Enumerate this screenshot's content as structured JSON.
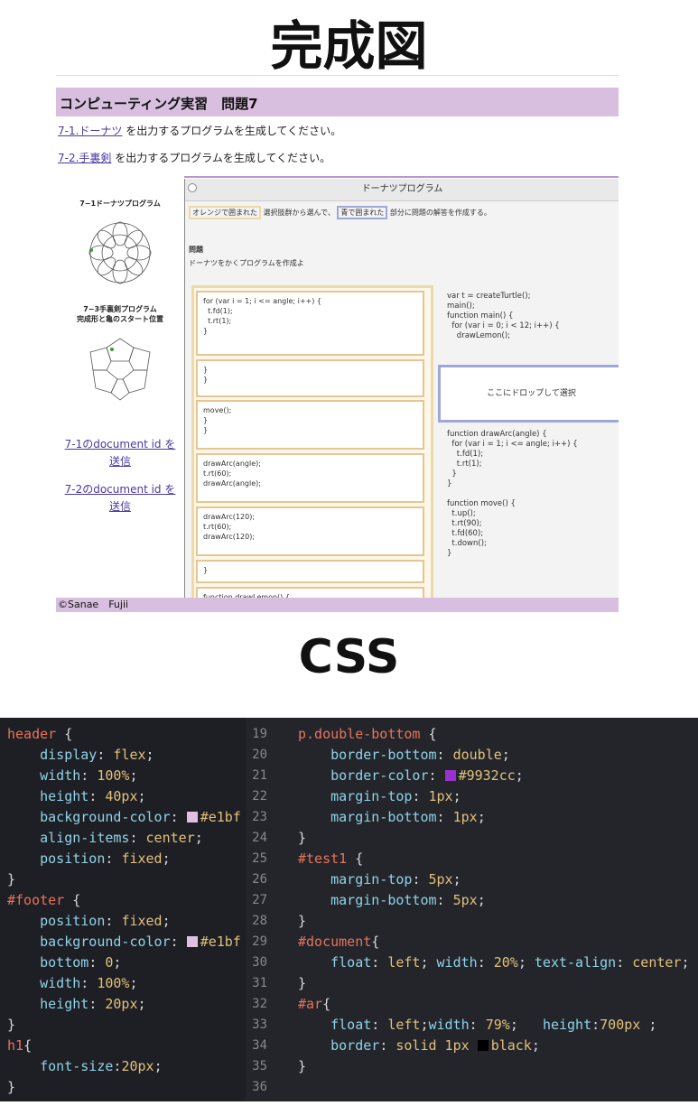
{
  "titles": {
    "top": "完成図",
    "css": "CSS"
  },
  "page": {
    "header": "コンピューティング実習　問題7",
    "q1": {
      "link": "7-1.ドーナツ",
      "text": " を出力するプログラムを生成してください。"
    },
    "q2": {
      "link": "7-2.手裏剣",
      "text": " を出力するプログラムを生成してください。"
    },
    "left": {
      "fig1": "7−1ドーナツプログラム",
      "fig2_line1": "7−3手裏剣プログラム",
      "fig2_line2": "完成形と亀のスタート位置",
      "link1_a": "7-1のdocument id を",
      "link1_b": "送信",
      "link2_a": "7-2のdocument id を",
      "link2_b": "送信"
    },
    "ar": {
      "title": "ドーナツプログラム",
      "instr_orange": "オレンジで囲まれた",
      "instr_mid": "選択肢群から選んで、",
      "instr_blue": "青で囲まれた",
      "instr_end": "部分に問題の解答を作成する。",
      "q_label": "問題",
      "q_text": "ドーナツをかくプログラムを作成よ",
      "boxes": [
        "for (var i = 1; i <= angle; i++) {\n  t.fd(1);\n  t.rt(1);\n}",
        "}\n}",
        "move();\n}\n}",
        "drawArc(angle);\nt.rt(60);\ndrawArc(angle);",
        "drawArc(120);\nt.rt(60);\ndrawArc(120);",
        "}",
        "function drawLemon() {"
      ],
      "code1": "var t = createTurtle();\nmain();\nfunction main() {\n  for (var i = 0; i < 12; i++) {\n    drawLemon();",
      "drop": "ここにドロップして選択",
      "code2": "function drawArc(angle) {\n  for (var i = 1; i <= angle; i++) {\n    t.fd(1);\n    t.rt(1);\n  }\n}\n\nfunction move() {\n  t.up();\n  t.rt(90);\n  t.fd(60);\n  t.down();\n}"
    },
    "footer": "©Sanae　Fujii"
  },
  "editor": {
    "left_lines": [
      [
        [
          "k",
          "header"
        ],
        [
          "n",
          " {"
        ]
      ],
      [
        [
          "n",
          "    "
        ],
        [
          "p",
          "display"
        ],
        [
          "n",
          ": "
        ],
        [
          "v",
          "flex"
        ],
        [
          "n",
          ";"
        ]
      ],
      [
        [
          "n",
          "    "
        ],
        [
          "p",
          "width"
        ],
        [
          "n",
          ": "
        ],
        [
          "v",
          "100%"
        ],
        [
          "n",
          ";"
        ]
      ],
      [
        [
          "n",
          "    "
        ],
        [
          "p",
          "height"
        ],
        [
          "n",
          ": "
        ],
        [
          "v",
          "40px"
        ],
        [
          "n",
          ";"
        ]
      ],
      [
        [
          "n",
          "    "
        ],
        [
          "p",
          "background-color"
        ],
        [
          "n",
          ": "
        ],
        [
          "sw",
          "#e1bfe1"
        ],
        [
          "v",
          "#e1bf"
        ]
      ],
      [
        [
          "n",
          "    "
        ],
        [
          "p",
          "align-items"
        ],
        [
          "n",
          ": "
        ],
        [
          "v",
          "center"
        ],
        [
          "n",
          ";"
        ]
      ],
      [
        [
          "n",
          "    "
        ],
        [
          "p",
          "position"
        ],
        [
          "n",
          ": "
        ],
        [
          "v",
          "fixed"
        ],
        [
          "n",
          ";"
        ]
      ],
      [
        [
          "n",
          "}"
        ]
      ],
      [
        [
          "k",
          "#footer"
        ],
        [
          "n",
          " {"
        ]
      ],
      [
        [
          "n",
          "    "
        ],
        [
          "p",
          "position"
        ],
        [
          "n",
          ": "
        ],
        [
          "v",
          "fixed"
        ],
        [
          "n",
          ";"
        ]
      ],
      [
        [
          "n",
          "    "
        ],
        [
          "p",
          "background-color"
        ],
        [
          "n",
          ": "
        ],
        [
          "sw",
          "#e1bfe1"
        ],
        [
          "v",
          "#e1bf"
        ]
      ],
      [
        [
          "n",
          "    "
        ],
        [
          "p",
          "bottom"
        ],
        [
          "n",
          ": "
        ],
        [
          "v",
          "0"
        ],
        [
          "n",
          ";"
        ]
      ],
      [
        [
          "n",
          "    "
        ],
        [
          "p",
          "width"
        ],
        [
          "n",
          ": "
        ],
        [
          "v",
          "100%"
        ],
        [
          "n",
          ";"
        ]
      ],
      [
        [
          "n",
          "    "
        ],
        [
          "p",
          "height"
        ],
        [
          "n",
          ": "
        ],
        [
          "v",
          "20px"
        ],
        [
          "n",
          ";"
        ]
      ],
      [
        [
          "n",
          "}"
        ]
      ],
      [
        [
          "k",
          "h1"
        ],
        [
          "n",
          "{"
        ]
      ],
      [
        [
          "n",
          "    "
        ],
        [
          "p",
          "font-size"
        ],
        [
          "n",
          ":"
        ],
        [
          "v",
          "20px"
        ],
        [
          "n",
          ";"
        ]
      ],
      [
        [
          "n",
          "}"
        ]
      ]
    ],
    "line_numbers": [
      "19",
      "20",
      "21",
      "22",
      "23",
      "24",
      "25",
      "26",
      "27",
      "28",
      "29",
      "30",
      "31",
      "32",
      "33",
      "34",
      "35",
      "36"
    ],
    "right_lines": [
      [
        [
          "k",
          "p.double-bottom"
        ],
        [
          "n",
          " {"
        ]
      ],
      [
        [
          "n",
          "    "
        ],
        [
          "p",
          "border-bottom"
        ],
        [
          "n",
          ": "
        ],
        [
          "v",
          "double"
        ],
        [
          "n",
          ";"
        ]
      ],
      [
        [
          "n",
          "    "
        ],
        [
          "p",
          "border-color"
        ],
        [
          "n",
          ": "
        ],
        [
          "sw",
          "#9932cc"
        ],
        [
          "v",
          "#9932cc"
        ],
        [
          "n",
          ";"
        ]
      ],
      [
        [
          "n",
          "    "
        ],
        [
          "p",
          "margin-top"
        ],
        [
          "n",
          ": "
        ],
        [
          "v",
          "1px"
        ],
        [
          "n",
          ";"
        ]
      ],
      [
        [
          "n",
          "    "
        ],
        [
          "p",
          "margin-bottom"
        ],
        [
          "n",
          ": "
        ],
        [
          "v",
          "1px"
        ],
        [
          "n",
          ";"
        ]
      ],
      [
        [
          "n",
          "}"
        ]
      ],
      [
        [
          "k",
          "#test1"
        ],
        [
          "n",
          " {"
        ]
      ],
      [
        [
          "n",
          "    "
        ],
        [
          "p",
          "margin-top"
        ],
        [
          "n",
          ": "
        ],
        [
          "v",
          "5px"
        ],
        [
          "n",
          ";"
        ]
      ],
      [
        [
          "n",
          "    "
        ],
        [
          "p",
          "margin-bottom"
        ],
        [
          "n",
          ": "
        ],
        [
          "v",
          "5px"
        ],
        [
          "n",
          ";"
        ]
      ],
      [
        [
          "n",
          "}"
        ]
      ],
      [
        [
          "k",
          "#document"
        ],
        [
          "n",
          "{"
        ]
      ],
      [
        [
          "n",
          "    "
        ],
        [
          "p",
          "float"
        ],
        [
          "n",
          ": "
        ],
        [
          "v",
          "left"
        ],
        [
          "n",
          "; "
        ],
        [
          "p",
          "width"
        ],
        [
          "n",
          ": "
        ],
        [
          "v",
          "20%"
        ],
        [
          "n",
          "; "
        ],
        [
          "p",
          "text-align"
        ],
        [
          "n",
          ": "
        ],
        [
          "v",
          "center"
        ],
        [
          "n",
          ";"
        ]
      ],
      [
        [
          "n",
          "}"
        ]
      ],
      [
        [
          "k",
          "#ar"
        ],
        [
          "n",
          "{"
        ]
      ],
      [
        [
          "n",
          "    "
        ],
        [
          "p",
          "float"
        ],
        [
          "n",
          ": "
        ],
        [
          "v",
          "left"
        ],
        [
          "n",
          ";"
        ],
        [
          "p",
          "width"
        ],
        [
          "n",
          ": "
        ],
        [
          "v",
          "79%"
        ],
        [
          "n",
          ";   "
        ],
        [
          "p",
          "height"
        ],
        [
          "n",
          ":"
        ],
        [
          "v",
          "700px"
        ],
        [
          "n",
          " ;"
        ]
      ],
      [
        [
          "n",
          "    "
        ],
        [
          "p",
          "border"
        ],
        [
          "n",
          ": "
        ],
        [
          "v",
          "solid 1px "
        ],
        [
          "sw",
          "#000000"
        ],
        [
          "v",
          "black"
        ],
        [
          "n",
          ";"
        ]
      ],
      [
        [
          "n",
          "}"
        ]
      ],
      [
        [
          "n",
          ""
        ]
      ]
    ]
  }
}
